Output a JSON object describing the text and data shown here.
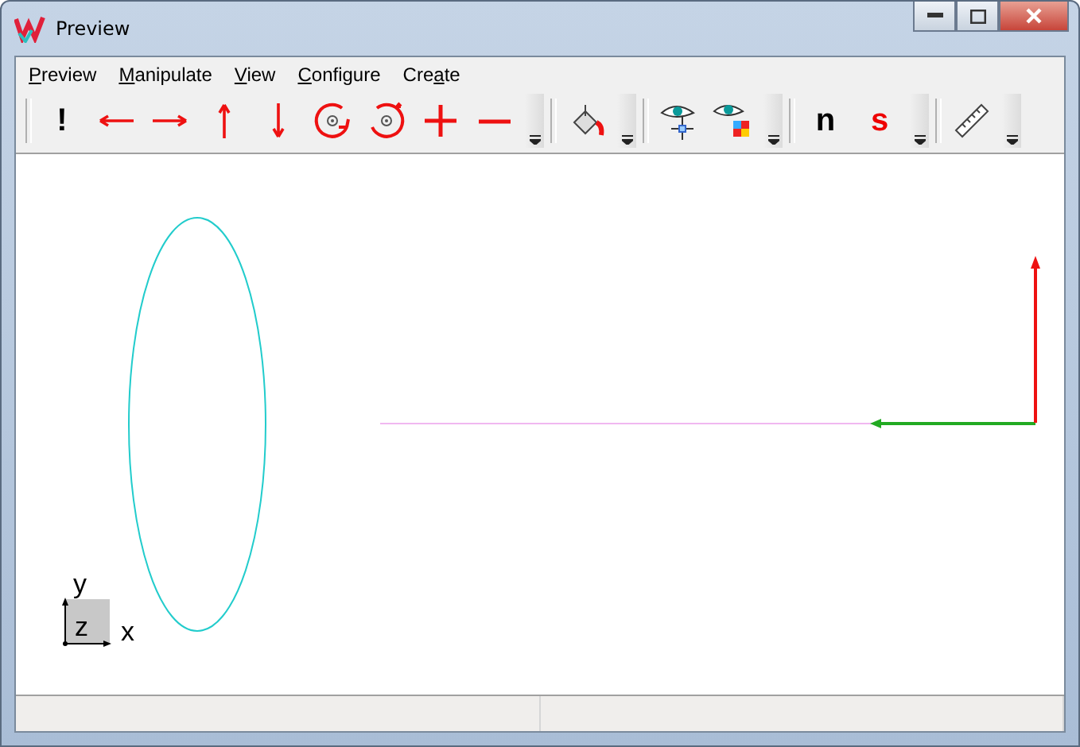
{
  "window": {
    "title": "Preview"
  },
  "menu": [
    {
      "key": "P",
      "after": "review"
    },
    {
      "key": "M",
      "after": "anipulate"
    },
    {
      "key": "V",
      "after": "iew"
    },
    {
      "key": "C",
      "after": "onfigure"
    },
    {
      "before": "Cre",
      "key": "a",
      "after": "te"
    }
  ],
  "toolbar": [
    {
      "kind": "sep"
    },
    {
      "kind": "text",
      "text": "!",
      "color": "#000000"
    },
    {
      "kind": "left"
    },
    {
      "kind": "right"
    },
    {
      "kind": "up"
    },
    {
      "kind": "down"
    },
    {
      "kind": "rotccw"
    },
    {
      "kind": "rotcw"
    },
    {
      "kind": "plus"
    },
    {
      "kind": "minus"
    },
    {
      "kind": "drop"
    },
    {
      "kind": "sep"
    },
    {
      "kind": "bucket"
    },
    {
      "kind": "drop"
    },
    {
      "kind": "sep"
    },
    {
      "kind": "eyecross"
    },
    {
      "kind": "eyegrid"
    },
    {
      "kind": "drop"
    },
    {
      "kind": "sep"
    },
    {
      "kind": "text",
      "text": "n",
      "color": "#000000"
    },
    {
      "kind": "text",
      "text": "s",
      "color": "#ee0000"
    },
    {
      "kind": "drop"
    },
    {
      "kind": "sep"
    },
    {
      "kind": "ruler"
    },
    {
      "kind": "drop"
    }
  ],
  "axes": {
    "y": "y",
    "z": "z",
    "x": "x"
  }
}
